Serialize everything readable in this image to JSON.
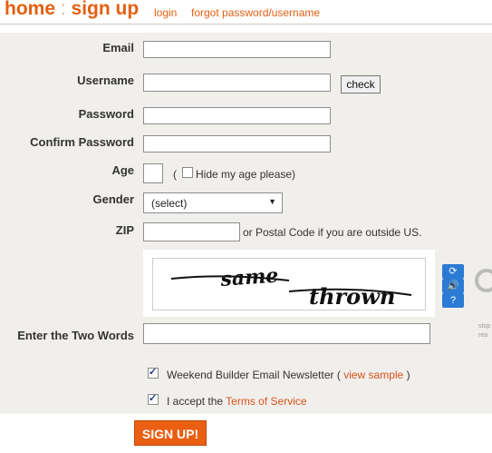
{
  "header": {
    "title_left": "home",
    "title_sep": ":",
    "title_right": "sign up",
    "login": "login",
    "forgot": "forgot password/username"
  },
  "form": {
    "email_label": "Email",
    "username_label": "Username",
    "check_button": "check",
    "password_label": "Password",
    "confirm_label": "Confirm Password",
    "age_label": "Age",
    "age_paren": "(",
    "hide_age": "Hide my age please)",
    "gender_label": "Gender",
    "gender_selected": "(select)",
    "zip_label": "ZIP",
    "zip_note": "or Postal Code if you are outside US.",
    "captcha_word1": "same",
    "captcha_word2": "thrown",
    "captcha_label": "Enter the Two Words",
    "newsletter_text": "Weekend Builder Email Newsletter (",
    "newsletter_link": "view sample",
    "newsletter_close": ")",
    "accept_text": "I accept the",
    "terms_link": "Terms of Service",
    "signup_button": "SIGN UP!",
    "side_text_1": "stop",
    "side_text_2": "rea"
  },
  "checkboxes": {
    "hide_age": false,
    "newsletter": true,
    "terms": true
  },
  "colors": {
    "accent": "#e35f10",
    "panel": "#f1efeb",
    "captcha_icons": "#2b7bd4"
  },
  "icons": [
    "refresh-icon",
    "audio-icon",
    "help-icon"
  ]
}
